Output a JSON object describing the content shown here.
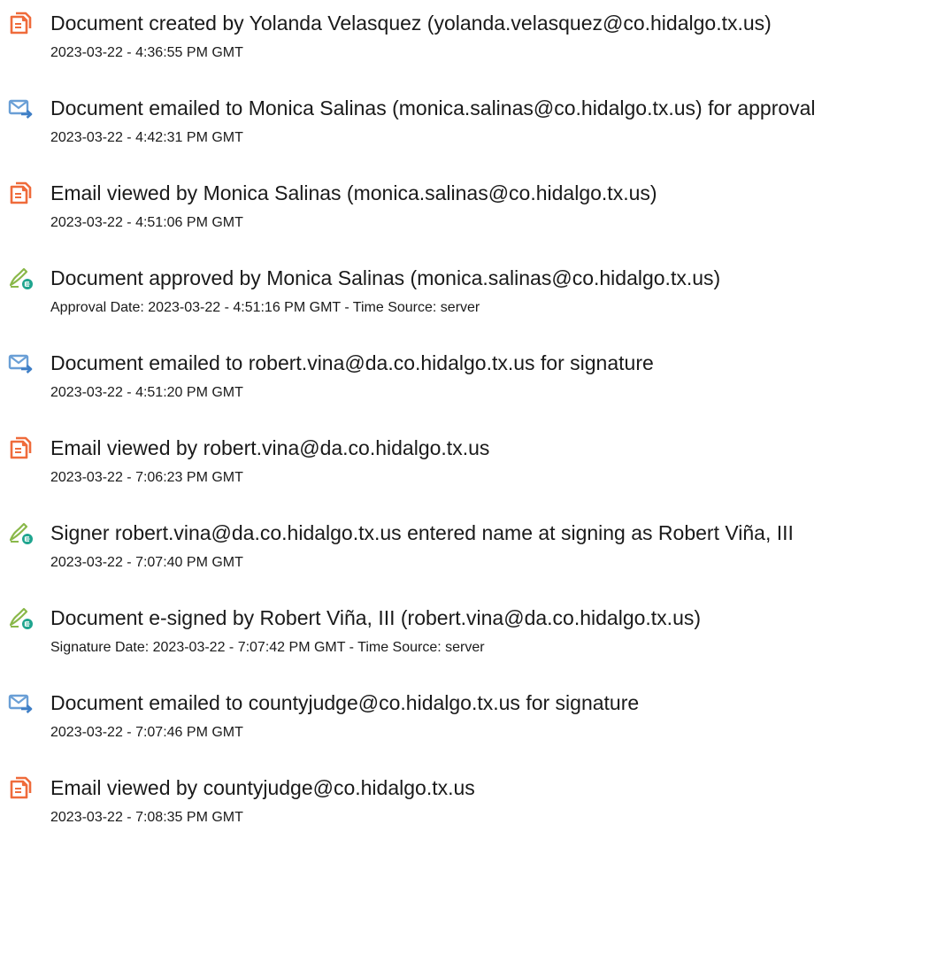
{
  "colors": {
    "document_icon": "#ef6b3b",
    "email_icon": "#6a9fd6",
    "sign_icon_pen": "#8ab84a",
    "sign_icon_badge": "#1fa58f",
    "text": "#1a1a1a"
  },
  "events": [
    {
      "icon": "document-icon",
      "title": "Document created by Yolanda Velasquez (yolanda.velasquez@co.hidalgo.tx.us)",
      "detail": "2023-03-22 - 4:36:55 PM GMT"
    },
    {
      "icon": "email-sent-icon",
      "title": "Document emailed to Monica Salinas (monica.salinas@co.hidalgo.tx.us) for approval",
      "detail": "2023-03-22 - 4:42:31 PM GMT"
    },
    {
      "icon": "document-icon",
      "title": "Email viewed by Monica Salinas (monica.salinas@co.hidalgo.tx.us)",
      "detail": "2023-03-22 - 4:51:06 PM GMT"
    },
    {
      "icon": "e-sign-icon",
      "title": "Document approved by Monica Salinas (monica.salinas@co.hidalgo.tx.us)",
      "detail": "Approval Date: 2023-03-22 - 4:51:16 PM GMT - Time Source: server"
    },
    {
      "icon": "email-sent-icon",
      "title": "Document emailed to robert.vina@da.co.hidalgo.tx.us for signature",
      "detail": "2023-03-22 - 4:51:20 PM GMT"
    },
    {
      "icon": "document-icon",
      "title": "Email viewed by robert.vina@da.co.hidalgo.tx.us",
      "detail": "2023-03-22 - 7:06:23 PM GMT"
    },
    {
      "icon": "e-sign-icon",
      "title": "Signer robert.vina@da.co.hidalgo.tx.us entered name at signing as Robert Viña, III",
      "detail": "2023-03-22 - 7:07:40 PM GMT"
    },
    {
      "icon": "e-sign-icon",
      "title": "Document e-signed by Robert Viña, III (robert.vina@da.co.hidalgo.tx.us)",
      "detail": "Signature Date: 2023-03-22 - 7:07:42 PM GMT - Time Source: server"
    },
    {
      "icon": "email-sent-icon",
      "title": "Document emailed to countyjudge@co.hidalgo.tx.us for signature",
      "detail": "2023-03-22 - 7:07:46 PM GMT"
    },
    {
      "icon": "document-icon",
      "title": "Email viewed by countyjudge@co.hidalgo.tx.us",
      "detail": "2023-03-22 - 7:08:35 PM GMT"
    }
  ]
}
